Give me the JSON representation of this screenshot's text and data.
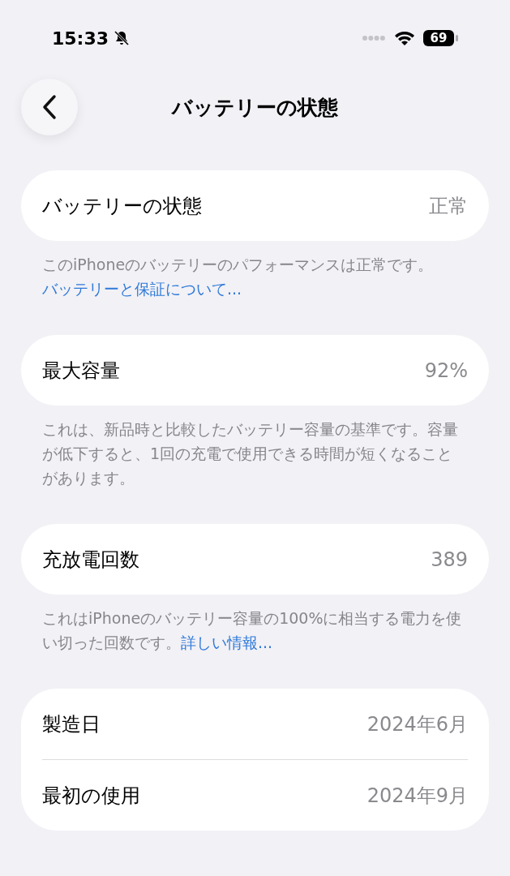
{
  "status_bar": {
    "time": "15:33",
    "silent": true,
    "battery": "69"
  },
  "nav": {
    "title": "バッテリーの状態"
  },
  "sections": [
    {
      "rows": [
        {
          "label": "バッテリーの状態",
          "value": "正常"
        }
      ],
      "footer": {
        "text": "このiPhoneのバッテリーのパフォーマンスは正常です。",
        "link": "バッテリーと保証について..."
      }
    },
    {
      "rows": [
        {
          "label": "最大容量",
          "value": "92%"
        }
      ],
      "footer": {
        "text": "これは、新品時と比較したバッテリー容量の基準です。容量が低下すると、1回の充電で使用できる時間が短くなることがあります。"
      }
    },
    {
      "rows": [
        {
          "label": "充放電回数",
          "value": "389"
        }
      ],
      "footer": {
        "text": "これはiPhoneのバッテリー容量の100%に相当する電力を使い切った回数です。",
        "link": "詳しい情報..."
      }
    },
    {
      "rows": [
        {
          "label": "製造日",
          "value": "2024年6月"
        },
        {
          "label": "最初の使用",
          "value": "2024年9月"
        }
      ]
    }
  ]
}
